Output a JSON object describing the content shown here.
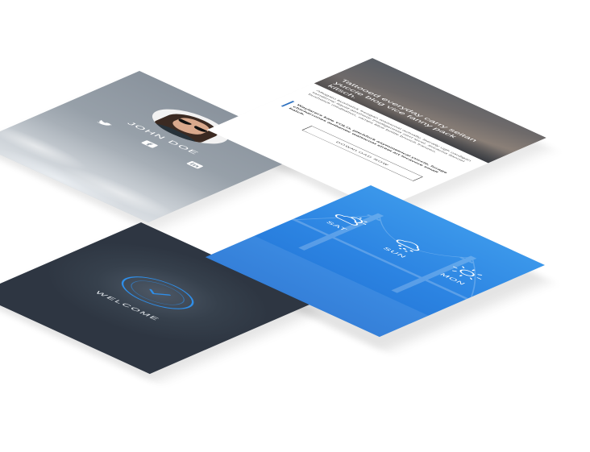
{
  "profile": {
    "name": "JOHN DOE",
    "social_icons": [
      "twitter-icon",
      "facebook-icon",
      "linkedin-icon"
    ]
  },
  "article": {
    "title": "Tattooed everyday carry seitan yuccie blog vice fanny pack kitsch.",
    "body": "Affogato bushwick freegan waistcoat actually, literally ugh cardigan taxidermy liquid aesthetic intelligentsia next level. Sriracha flannel bushwick meditation, ramps blue bottle brunch franzen.",
    "quote": "Wayfarers kale YOLO, pitchfork asymmetrical yuccie, forage chicharrones authentic waistcoat street art locavore small batch.",
    "button_label": "DOWNLOAD NOW"
  },
  "welcome": {
    "label": "WELCOME",
    "icon": "check-clock-icon"
  },
  "weather": {
    "days": [
      {
        "label": "SAT",
        "icon": "partly-cloudy-icon"
      },
      {
        "label": "SUN",
        "icon": "rain-cloud-icon"
      },
      {
        "label": "MON",
        "icon": "sun-icon"
      }
    ]
  },
  "colors": {
    "accent_blue": "#2f8ee8",
    "weather_bg": "#2c84e2",
    "welcome_bg": "#36404c",
    "profile_bg": "#97a0a9"
  }
}
